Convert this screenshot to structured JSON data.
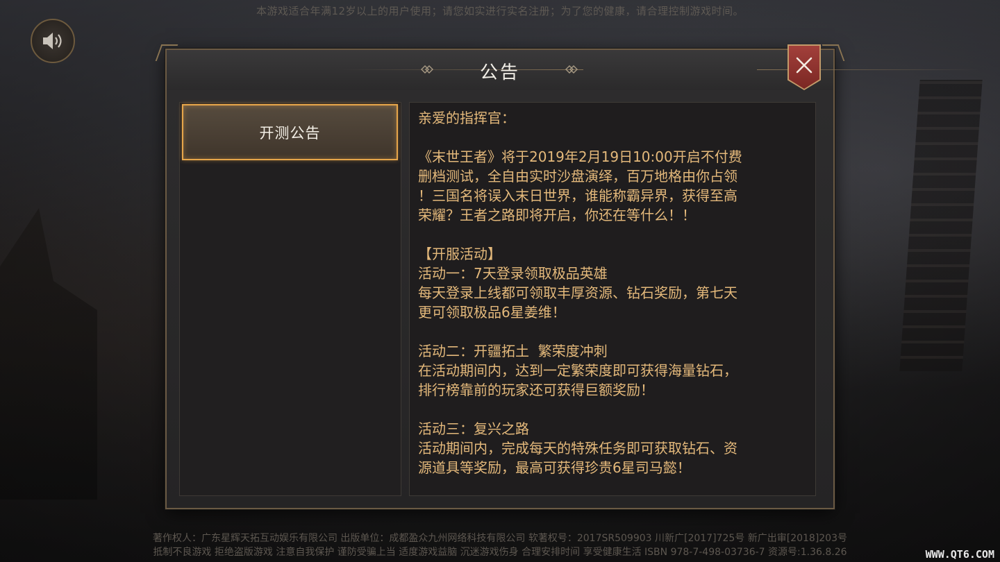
{
  "top_notice": "本游戏适合年满12岁以上的用户使用；请您如实进行实名注册；为了您的健康，请合理控制游戏时间。",
  "dialog": {
    "title": "公告",
    "tab": "开测公告",
    "content": [
      "亲爱的指挥官：",
      "",
      "《末世王者》将于2019年2月19日10:00开启不付费",
      "删档测试，全自由实时沙盘演绎，百万地格由你占领",
      "！三国名将误入末日世界，谁能称霸异界，获得至高",
      "荣耀？王者之路即将开启，你还在等什么！！",
      "",
      "【开服活动】",
      "活动一：7天登录领取极品英雄",
      "每天登录上线都可领取丰厚资源、钻石奖励，第七天",
      "更可领取极品6星姜维！",
      "",
      "活动二：开疆拓土  繁荣度冲刺",
      "在活动期间内，达到一定繁荣度即可获得海量钻石，",
      "排行榜靠前的玩家还可获得巨额奖励！",
      "",
      "活动三：复兴之路",
      "活动期间内，完成每天的特殊任务即可获取钻石、资",
      "源道具等奖励，最高可获得珍贵6星司马懿！"
    ]
  },
  "footer": {
    "line1": "著作权人：广东星辉天拓互动娱乐有限公司   出版单位：成都盈众九州网络科技有限公司   软著权号：2017SR509903   川新广[2017]725号   新广出审[2018]203号",
    "line2": "抵制不良游戏  拒绝盗版游戏  注意自我保护  谨防受骗上当  适度游戏益脑  沉迷游戏伤身  合理安排时间  享受健康生活   ISBN 978-7-498-03736-7   资源号:1.36.8.26"
  },
  "watermark": "WWW.QT6.COM",
  "icons": {
    "sound": "speaker-icon",
    "close": "close-icon"
  },
  "colors": {
    "accent_gold": "#e7a64a",
    "text_gold": "#e4b97b",
    "close_red": "#8f332e"
  }
}
